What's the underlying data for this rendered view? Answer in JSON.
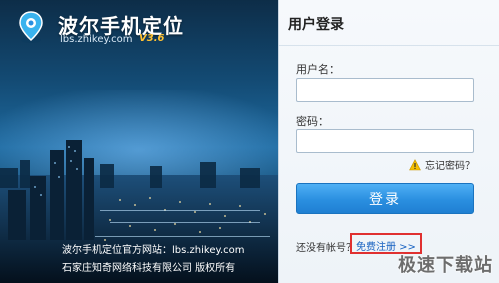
{
  "app": {
    "title": "波尔手机定位",
    "domain": "lbs.zhikey.com",
    "version": "V3.6"
  },
  "footer": {
    "site_line": "波尔手机定位官方网站：lbs.zhikey.com",
    "copyright": "石家庄知奇网络科技有限公司 版权所有"
  },
  "login": {
    "title": "用户登录",
    "username_label": "用户名：",
    "username_value": "",
    "password_label": "密码：",
    "password_value": "",
    "forgot_label": "忘记密码？",
    "submit_label": "登录",
    "no_account_text": "还没有帐号？",
    "register_label": "免费注册 >>"
  },
  "watermark": "极速下载站",
  "colors": {
    "accent": "#2a8fe0",
    "register_border": "#e03030",
    "link": "#1560c0"
  },
  "icons": {
    "logo": "location-pin-logo",
    "forgot": "warning-icon"
  }
}
